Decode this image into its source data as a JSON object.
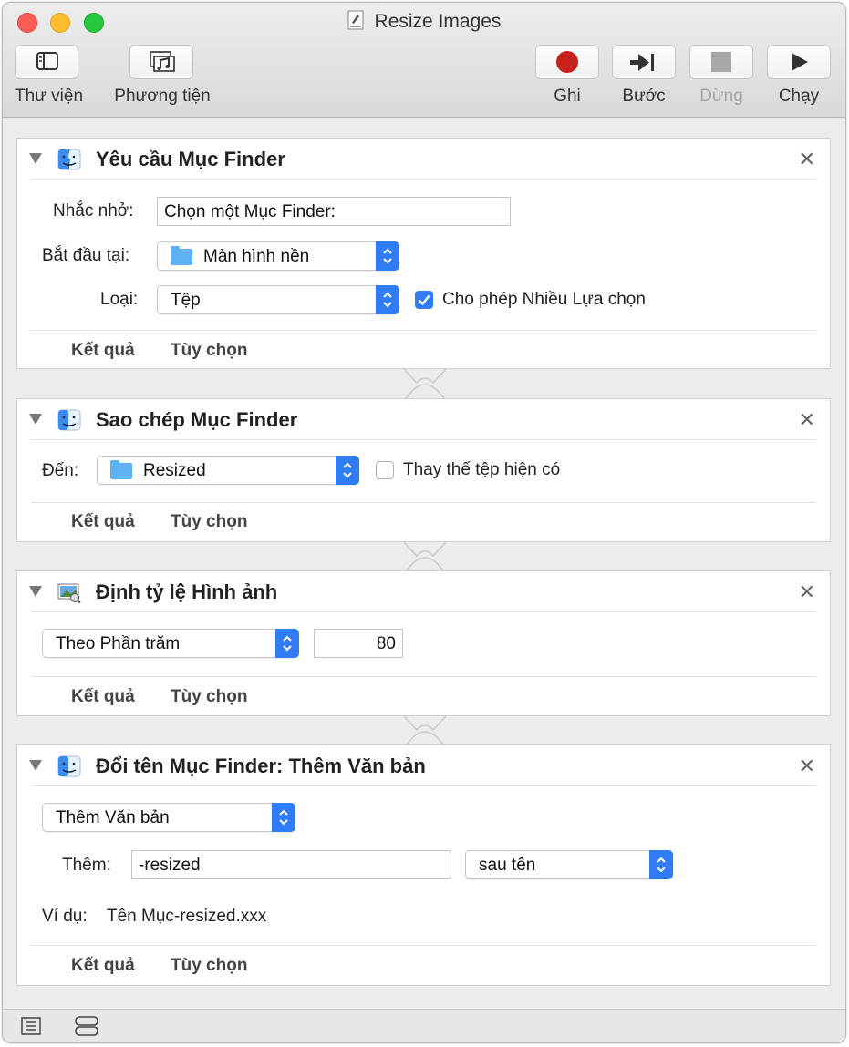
{
  "window": {
    "title": "Resize Images"
  },
  "toolbar": {
    "library_label": "Thư viện",
    "media_label": "Phương tiện",
    "record_label": "Ghi",
    "step_label": "Bước",
    "stop_label": "Dừng",
    "run_label": "Chạy"
  },
  "actions": [
    {
      "title": "Yêu cầu Mục Finder",
      "prompt_label": "Nhắc nhở:",
      "prompt_value": "Chọn một Mục Finder:",
      "start_label": "Bắt đầu tại:",
      "start_value": "Màn hình nền",
      "type_label": "Loại:",
      "type_value": "Tệp",
      "allow_multiple_label": "Cho phép Nhiều Lựa chọn",
      "allow_multiple_checked": true,
      "results_label": "Kết quả",
      "options_label": "Tùy chọn"
    },
    {
      "title": "Sao chép Mục Finder",
      "to_label": "Đến:",
      "to_value": "Resized",
      "replace_label": "Thay thế tệp hiện có",
      "replace_checked": false,
      "results_label": "Kết quả",
      "options_label": "Tùy chọn"
    },
    {
      "title": "Định tỷ lệ Hình ảnh",
      "mode_value": "Theo Phần trăm",
      "percent_value": "80",
      "results_label": "Kết quả",
      "options_label": "Tùy chọn"
    },
    {
      "title": "Đổi tên Mục Finder: Thêm Văn bản",
      "mode_value": "Thêm Văn bản",
      "add_label": "Thêm:",
      "add_value": "-resized",
      "position_value": "sau tên",
      "example_label": "Ví dụ:",
      "example_value": "Tên Mục-resized.xxx",
      "results_label": "Kết quả",
      "options_label": "Tùy chọn"
    }
  ],
  "icons": {
    "library": "sidebar-icon",
    "media": "media-icon",
    "record": "record-icon",
    "step": "step-icon",
    "stop": "stop-icon",
    "run": "play-icon",
    "finder": "finder-icon",
    "preview": "preview-icon",
    "log": "list-icon",
    "variables": "variables-icon"
  },
  "colors": {
    "accent": "#2f7cf6",
    "record": "#c8201b",
    "folder": "#5db1f4"
  }
}
